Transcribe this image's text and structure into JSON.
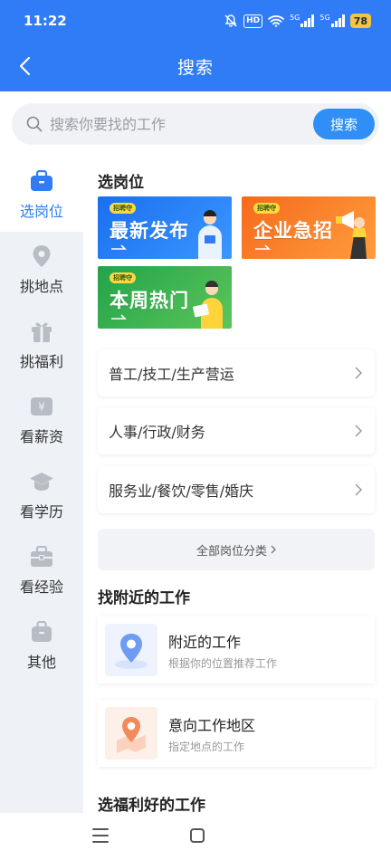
{
  "status_bar": {
    "time": "11:22",
    "hd": "HD",
    "signal1": "5G",
    "signal2": "5G",
    "battery": "78"
  },
  "nav": {
    "title": "搜索"
  },
  "search": {
    "placeholder": "搜索你要找的工作",
    "button": "搜索"
  },
  "sidebar": {
    "items": [
      {
        "label": "选岗位",
        "icon": "briefcase-icon",
        "active": true
      },
      {
        "label": "挑地点",
        "icon": "location-pin-icon"
      },
      {
        "label": "挑福利",
        "icon": "gift-icon"
      },
      {
        "label": "看薪资",
        "icon": "yuan-wallet-icon"
      },
      {
        "label": "看学历",
        "icon": "graduation-cap-icon"
      },
      {
        "label": "看经验",
        "icon": "toolbox-icon"
      },
      {
        "label": "其他",
        "icon": "bag-icon"
      }
    ]
  },
  "main": {
    "section1_title": "选岗位",
    "banners": [
      {
        "tag": "招聘夺",
        "title": "最新发布",
        "color": "#1f72f0"
      },
      {
        "tag": "招聘夺",
        "title": "企业急招",
        "color": "#f26b22"
      },
      {
        "tag": "招聘夺",
        "title": "本周热门",
        "color": "#2ba24b"
      }
    ],
    "categories": [
      "普工/技工/生产营运",
      "人事/行政/财务",
      "服务业/餐饮/零售/婚庆"
    ],
    "all_categories": "全部岗位分类",
    "section2_title": "找附近的工作",
    "nearby": [
      {
        "title": "附近的工作",
        "subtitle": "根据你的位置推荐工作",
        "icon": "location-pin-icon"
      },
      {
        "title": "意向工作地区",
        "subtitle": "指定地点的工作",
        "icon": "map-pin-icon"
      }
    ],
    "section3_title": "选福利好的工作"
  },
  "colors": {
    "primary": "#2f7cf6",
    "search_button": "#2f8ff7"
  }
}
